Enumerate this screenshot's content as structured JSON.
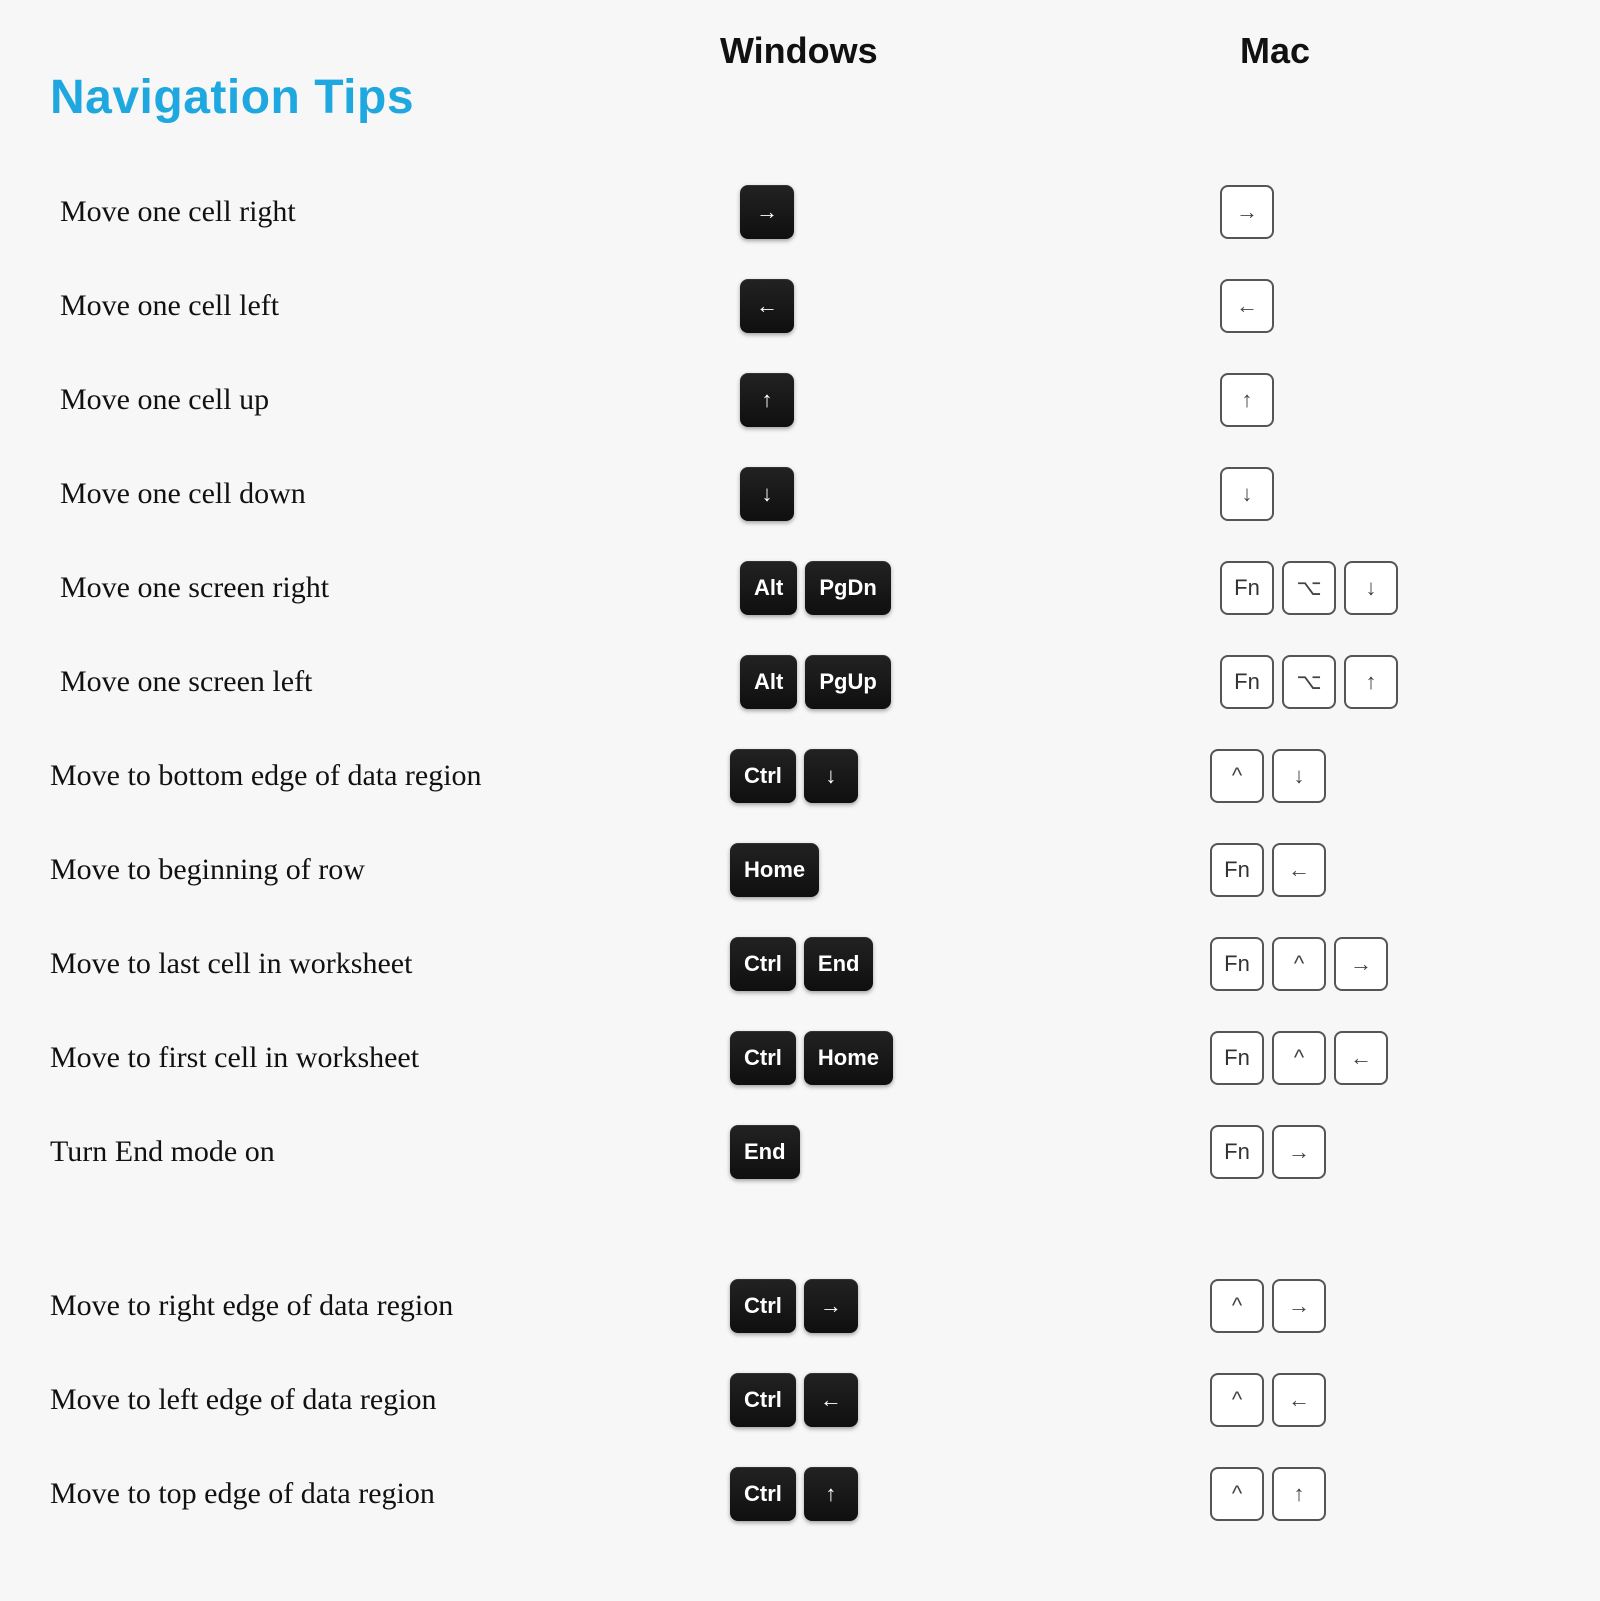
{
  "title": "Navigation Tips",
  "columns": {
    "windows": "Windows",
    "mac": "Mac"
  },
  "rows": [
    {
      "label": "Move one cell right",
      "win": [
        {
          "glyph": "→",
          "sq": true
        }
      ],
      "mac": [
        {
          "glyph": "→",
          "sq": true
        }
      ]
    },
    {
      "label": "Move one cell left",
      "win": [
        {
          "glyph": "←",
          "sq": true
        }
      ],
      "mac": [
        {
          "glyph": "←",
          "sq": true
        }
      ]
    },
    {
      "label": "Move one cell up",
      "win": [
        {
          "glyph": "↑",
          "sq": true
        }
      ],
      "mac": [
        {
          "glyph": "↑",
          "sq": true
        }
      ]
    },
    {
      "label": "Move one cell down",
      "win": [
        {
          "glyph": "↓",
          "sq": true
        }
      ],
      "mac": [
        {
          "glyph": "↓",
          "sq": true
        }
      ]
    },
    {
      "label": "Move one screen right",
      "win": [
        {
          "glyph": "Alt"
        },
        {
          "glyph": "PgDn"
        }
      ],
      "mac": [
        {
          "glyph": "Fn"
        },
        {
          "glyph": "⌥",
          "sq": true
        },
        {
          "glyph": "↓",
          "sq": true
        }
      ]
    },
    {
      "label": "Move one screen left",
      "win": [
        {
          "glyph": "Alt"
        },
        {
          "glyph": "PgUp"
        }
      ],
      "mac": [
        {
          "glyph": "Fn"
        },
        {
          "glyph": "⌥",
          "sq": true
        },
        {
          "glyph": "↑",
          "sq": true
        }
      ]
    },
    {
      "label": "Move to bottom edge of data region",
      "win": [
        {
          "glyph": "Ctrl"
        },
        {
          "glyph": "↓",
          "sq": true
        }
      ],
      "mac": [
        {
          "glyph": "^",
          "sq": true
        },
        {
          "glyph": "↓",
          "sq": true
        }
      ]
    },
    {
      "label": "Move to beginning of row",
      "win": [
        {
          "glyph": "Home"
        }
      ],
      "mac": [
        {
          "glyph": "Fn"
        },
        {
          "glyph": "←",
          "sq": true
        }
      ]
    },
    {
      "label": "Move to last cell in worksheet",
      "win": [
        {
          "glyph": "Ctrl"
        },
        {
          "glyph": "End"
        }
      ],
      "mac": [
        {
          "glyph": "Fn"
        },
        {
          "glyph": "^",
          "sq": true
        },
        {
          "glyph": "→",
          "sq": true
        }
      ]
    },
    {
      "label": "Move to first cell in worksheet",
      "win": [
        {
          "glyph": "Ctrl"
        },
        {
          "glyph": "Home"
        }
      ],
      "mac": [
        {
          "glyph": "Fn"
        },
        {
          "glyph": "^",
          "sq": true
        },
        {
          "glyph": "←",
          "sq": true
        }
      ]
    },
    {
      "label": "Turn End mode on",
      "win": [
        {
          "glyph": "End"
        }
      ],
      "mac": [
        {
          "glyph": "Fn"
        },
        {
          "glyph": "→",
          "sq": true
        }
      ]
    },
    {
      "gap": true,
      "label": "Move to right edge of data region",
      "win": [
        {
          "glyph": "Ctrl"
        },
        {
          "glyph": "→",
          "sq": true
        }
      ],
      "mac": [
        {
          "glyph": "^",
          "sq": true
        },
        {
          "glyph": "→",
          "sq": true
        }
      ]
    },
    {
      "label": "Move to left edge of data region",
      "win": [
        {
          "glyph": "Ctrl"
        },
        {
          "glyph": "←",
          "sq": true
        }
      ],
      "mac": [
        {
          "glyph": "^",
          "sq": true
        },
        {
          "glyph": "←",
          "sq": true
        }
      ]
    },
    {
      "label": "Move to top edge of data region",
      "win": [
        {
          "glyph": "Ctrl"
        },
        {
          "glyph": "↑",
          "sq": true
        }
      ],
      "mac": [
        {
          "glyph": "^",
          "sq": true
        },
        {
          "glyph": "↑",
          "sq": true
        }
      ]
    }
  ]
}
